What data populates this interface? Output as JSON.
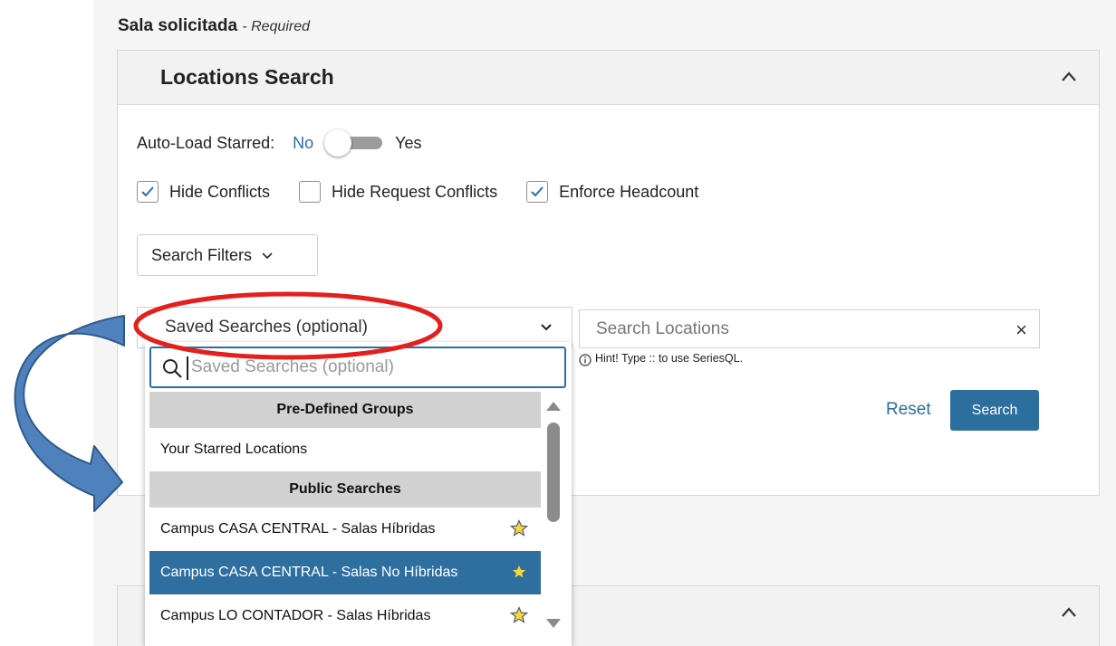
{
  "section": {
    "label": "Sala solicitada",
    "required": "- Required"
  },
  "panel": {
    "title": "Locations Search"
  },
  "autoload": {
    "label": "Auto-Load Starred:",
    "no": "No",
    "yes": "Yes"
  },
  "checks": [
    {
      "label": "Hide Conflicts",
      "checked": true
    },
    {
      "label": "Hide Request Conflicts",
      "checked": false
    },
    {
      "label": "Enforce Headcount",
      "checked": true
    }
  ],
  "filters": {
    "label": "Search Filters"
  },
  "saved": {
    "value": "Saved Searches (optional)",
    "search_placeholder": "Saved Searches (optional)"
  },
  "search": {
    "placeholder": "Search Locations",
    "clear": "×",
    "hint": "Hint! Type :: to use SeriesQL."
  },
  "actions": {
    "reset": "Reset",
    "search": "Search"
  },
  "dropdown": {
    "groups": [
      {
        "title": "Pre-Defined Groups",
        "options": [
          {
            "label": "Your Starred Locations",
            "star": false,
            "selected": false
          }
        ]
      },
      {
        "title": "Public Searches",
        "options": [
          {
            "label": "Campus CASA CENTRAL - Salas Híbridas",
            "star": true,
            "selected": false
          },
          {
            "label": "Campus CASA CENTRAL - Salas No Híbridas",
            "star": true,
            "selected": true
          },
          {
            "label": "Campus LO CONTADOR - Salas Híbridas",
            "star": true,
            "selected": false
          }
        ]
      }
    ]
  },
  "colors": {
    "accent": "#2a6ea6",
    "selected_bg": "#2f6f9f",
    "annotation_red": "#e4201f",
    "arrow_blue": "#4f81bd",
    "star": "#f5d63d"
  }
}
